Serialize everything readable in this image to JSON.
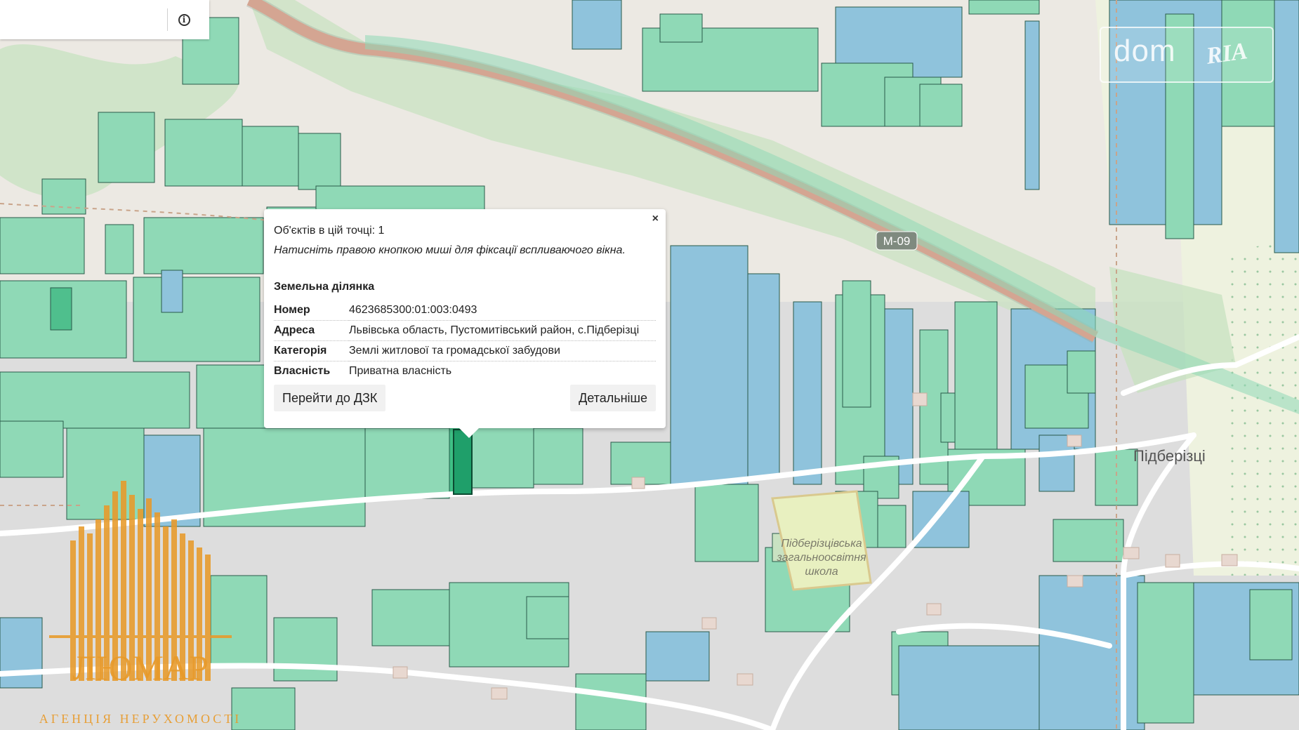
{
  "search": {
    "value": "",
    "info_icon": "info-icon",
    "info_glyph": "i"
  },
  "watermark": {
    "dom_text": "dom",
    "ria_text": "RIA"
  },
  "map": {
    "road_label": "М-09",
    "village_label": "Підберізці",
    "school_label": [
      "Підберізцівська",
      "загальноосвітня",
      "школа"
    ]
  },
  "popup": {
    "close_glyph": "×",
    "objects_count": "Об'єктів в цій точці: 1",
    "hint": "Натисніть правою кнопкою миші для фіксації вспливаючого вікна.",
    "heading": "Земельна ділянка",
    "rows": [
      {
        "key": "Номер",
        "value": "4623685300:01:003:0493"
      },
      {
        "key": "Адреса",
        "value": "Львівська область, Пустомитівський район, с.Підберізці"
      },
      {
        "key": "Категорія",
        "value": "Землі житлової та громадської забудови"
      },
      {
        "key": "Власність",
        "value": "Приватна власність"
      }
    ],
    "btn_dzk": "Перейти до ДЗК",
    "btn_details": "Детальніше"
  },
  "logo": {
    "name": "ЛЮМАР",
    "tagline": "АГЕНЦІЯ НЕРУХОМОСТІ"
  },
  "colors": {
    "parcel_green": "#8fd9b6",
    "parcel_blue": "#8fc3dc",
    "parcel_stroke": "#2a5a4a",
    "road_red": "#f3a58e"
  }
}
